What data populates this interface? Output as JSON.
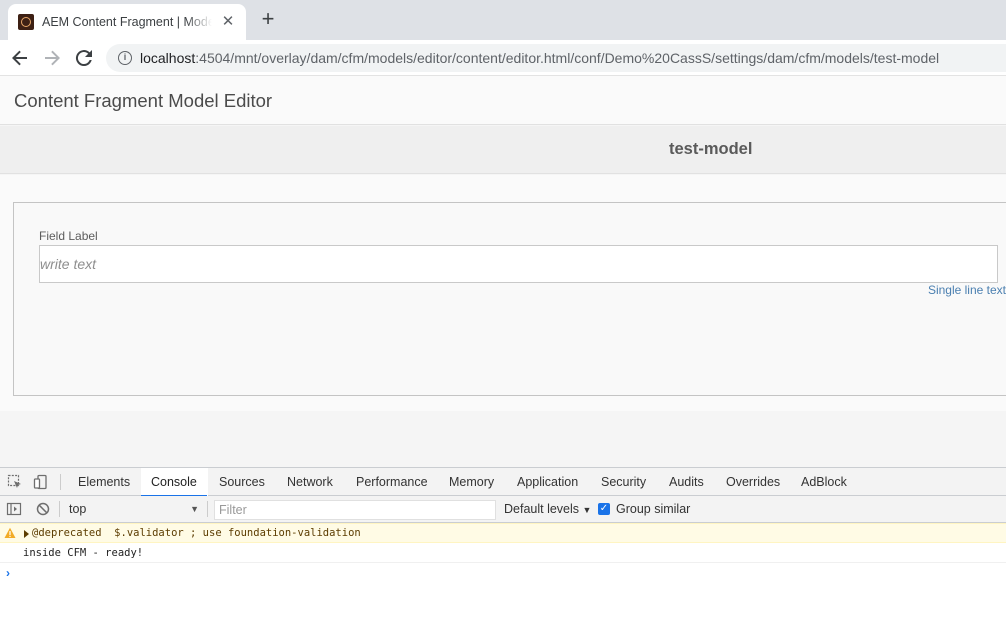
{
  "browser": {
    "tab_title": "AEM Content Fragment | Model",
    "url_host": "localhost",
    "url_path": ":4504/mnt/overlay/dam/cfm/models/editor/content/editor.html/conf/Demo%20CassS/settings/dam/cfm/models/test-model"
  },
  "editor": {
    "title": "Content Fragment Model Editor",
    "model_name": "test-model",
    "field": {
      "label": "Field Label",
      "placeholder": "write text",
      "type": "Single line text"
    }
  },
  "devtools": {
    "tabs": [
      "Elements",
      "Console",
      "Sources",
      "Network",
      "Performance",
      "Memory",
      "Application",
      "Security",
      "Audits",
      "Overrides",
      "AdBlock"
    ],
    "active_tab": "Console",
    "context": "top",
    "filter_placeholder": "Filter",
    "levels": "Default levels",
    "group_similar": "Group similar",
    "group_similar_checked": true,
    "messages": [
      {
        "level": "warning",
        "text": "@deprecated  $.validator ; use foundation-validation"
      },
      {
        "level": "log",
        "text": "inside CFM - ready!"
      }
    ],
    "prompt_symbol": "›"
  },
  "colors": {
    "accent": "#1a73e8",
    "link": "#4a7fb0",
    "warning_bg": "#fffbe5"
  }
}
